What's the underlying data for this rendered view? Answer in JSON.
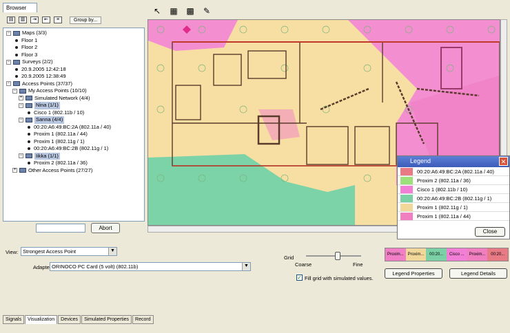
{
  "browser": {
    "tab_label": "Browser",
    "group_by_label": "Group by...",
    "tree": [
      {
        "label": "Maps (3/3)",
        "toggle": "⊟"
      },
      {
        "label": "Floor 1"
      },
      {
        "label": "Floor 2"
      },
      {
        "label": "Floor 3"
      },
      {
        "label": "Surveys (2/2)",
        "toggle": "⊟"
      },
      {
        "label": "20.9.2005 12:42:18"
      },
      {
        "label": "20.9.2005 12:38:49"
      },
      {
        "label": "Access Points (37/37)",
        "toggle": "⊟"
      },
      {
        "label": "My Access Points (10/10)",
        "toggle": "⊟"
      },
      {
        "label": "Simulated Network (4/4)",
        "toggle": "⊞"
      },
      {
        "label": "Nina (1/1)",
        "toggle": "⊟"
      },
      {
        "label": "Cisco 1 (802.11b / 10)"
      },
      {
        "label": "Sanna (4/4)",
        "toggle": "⊟"
      },
      {
        "label": "00:20:A6:49:BC:2A (802.11a / 40)"
      },
      {
        "label": "Proxim 1 (802.11a / 44)"
      },
      {
        "label": "Proxim 1 (802.11g / 1)"
      },
      {
        "label": "00:20:A6:49:BC:2B (802.11g / 1)"
      },
      {
        "label": "Iikka (1/1)",
        "toggle": "⊟"
      },
      {
        "label": "Proxim 2 (802.11a / 36)"
      },
      {
        "label": "Other Access Points (27/27)",
        "toggle": "⊞"
      }
    ],
    "abort_label": "Abort"
  },
  "legend": {
    "title": "Legend",
    "items": [
      {
        "label": "00:20:A6:49:BC:2A (802.11a / 40)",
        "color": "#e87a86"
      },
      {
        "label": "Proxim 2 (802.11a / 36)",
        "color": "#9be07a"
      },
      {
        "label": "Cisco 1 (802.11b / 10)",
        "color": "#f17fd6"
      },
      {
        "label": "00:20:A6:49:BC:2B (802.11g / 1)",
        "color": "#7cd0a6"
      },
      {
        "label": "Proxim 1 (802.11g / 1)",
        "color": "#f2d79a"
      },
      {
        "label": "Proxim 1 (802.11a / 44)",
        "color": "#f07fc0"
      }
    ],
    "close_label": "Close"
  },
  "bottom": {
    "view_label": "View:",
    "view_value": "Strongest Access Point",
    "adapter_label": "Adapter",
    "adapter_value": "ORINOCO PC Card (5 volt) (802.11b)",
    "grid_label": "Grid",
    "coarse_label": "Coarse",
    "fine_label": "Fine",
    "fill_label": "Fill grid with simulated values.",
    "strip": [
      "Proxim...",
      "Proxim...",
      "00:20...",
      "Cisco ...",
      "Proxim...",
      "00:20..."
    ],
    "legend_properties_label": "Legend Properties",
    "legend_details_label": "Legend Details"
  },
  "tabs": [
    "Signals",
    "Visualization",
    "Devices",
    "Simulated Properties",
    "Record"
  ]
}
